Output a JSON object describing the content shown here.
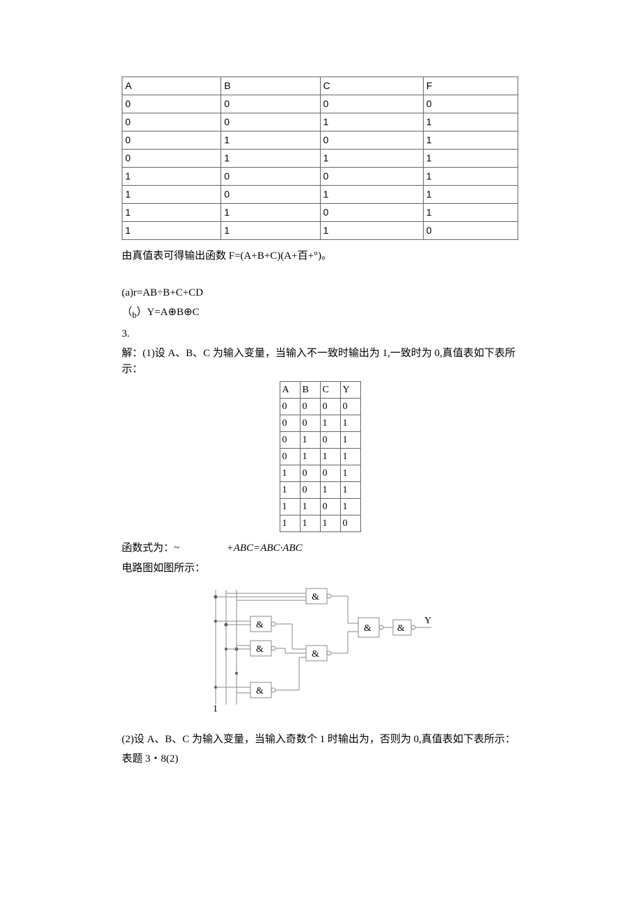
{
  "table1": {
    "headers": [
      "A",
      "B",
      "C",
      "F"
    ],
    "rows": [
      [
        "0",
        "0",
        "0",
        "0"
      ],
      [
        "0",
        "0",
        "1",
        "1"
      ],
      [
        "0",
        "1",
        "0",
        "1"
      ],
      [
        "0",
        "1",
        "1",
        "1"
      ],
      [
        "1",
        "0",
        "0",
        "1"
      ],
      [
        "1",
        "0",
        "1",
        "1"
      ],
      [
        "1",
        "1",
        "0",
        "1"
      ],
      [
        "1",
        "1",
        "1",
        "0"
      ]
    ]
  },
  "text": {
    "line1": "由真值表可得输出函数 F=(A+B+C)(A+百+°)。",
    "item_a": "(a)r=AB÷B+C+CD",
    "item_b_prefix": "（",
    "item_b_sub": "b",
    "item_b_suffix": "）Y=A⊕B⊕C",
    "num3": "3.",
    "sol_intro": "解：(1)设 A、B、C 为输入变量，当输入不一致时输出为 1,一致时为 0,真值表如下表所示：",
    "func_label": "函数式为：~",
    "func_mid": "+ABC=ABC·ABC",
    "circuit_label": "电路图如图所示：",
    "part2": "(2)设 A、B、C 为输入变量，当输入奇数个 1 时输出为，否则为 0,真值表如下表所示：",
    "tbl_title": "表题 3・8(2)",
    "y_label": "Y",
    "one_label": "1",
    "amp": "&"
  },
  "table2": {
    "headers": [
      "A",
      "B",
      "C",
      "Y"
    ],
    "rows": [
      [
        "0",
        "0",
        "0",
        "0"
      ],
      [
        "0",
        "0",
        "1",
        "1"
      ],
      [
        "0",
        "1",
        "0",
        "1"
      ],
      [
        "0",
        "1",
        "1",
        "1"
      ],
      [
        "1",
        "0",
        "0",
        "1"
      ],
      [
        "1",
        "0",
        "1",
        "1"
      ],
      [
        "1",
        "1",
        "0",
        "1"
      ],
      [
        "1",
        "1",
        "1",
        "0"
      ]
    ]
  }
}
